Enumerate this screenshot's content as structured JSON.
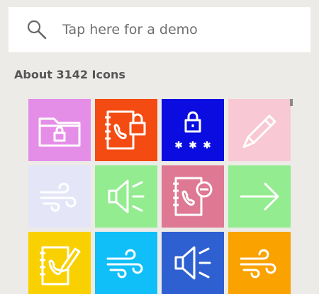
{
  "search": {
    "placeholder": "Tap here for a demo",
    "value": ""
  },
  "results": {
    "count_label": "About 3142 Icons"
  },
  "icons": [
    {
      "name": "folder-lock-icon",
      "color": "#e58ee8"
    },
    {
      "name": "phonebook-lock-icon",
      "color": "#f44b12"
    },
    {
      "name": "password-lock-icon",
      "color": "#0a0ce0"
    },
    {
      "name": "pencil-icon",
      "color": "#f8c8d4"
    },
    {
      "name": "wind-icon",
      "color": "#e4e6f8"
    },
    {
      "name": "speaker-volume-icon",
      "color": "#94ec90"
    },
    {
      "name": "phonebook-remove-icon",
      "color": "#de7893"
    },
    {
      "name": "arrow-right-icon",
      "color": "#94ec90"
    },
    {
      "name": "phonebook-edit-icon",
      "color": "#f9d000"
    },
    {
      "name": "wind-icon",
      "color": "#10bff8"
    },
    {
      "name": "speaker-volume-icon",
      "color": "#2f60d2"
    },
    {
      "name": "wind-icon",
      "color": "#f9a200"
    }
  ]
}
